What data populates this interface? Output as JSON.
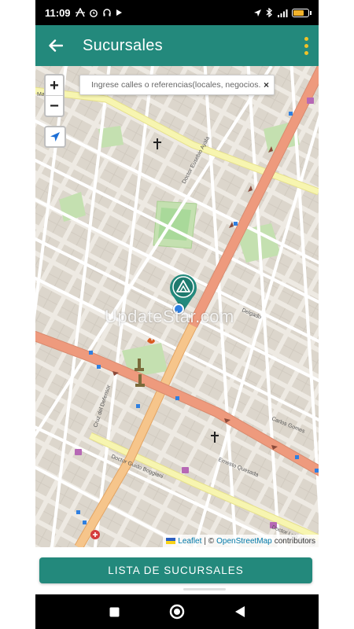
{
  "status_bar": {
    "time": "11:09",
    "battery_level": 0.75,
    "icons_left": [
      "network-activity-icon",
      "alarm-icon",
      "headset-icon",
      "play-icon"
    ],
    "icons_right": [
      "location-icon",
      "bluetooth-icon",
      "signal-icon",
      "battery-icon"
    ]
  },
  "app_bar": {
    "title": "Sucursales",
    "back_icon": "arrow-left-icon",
    "menu_icon": "more-vert-icon"
  },
  "map": {
    "zoom_in_label": "+",
    "zoom_out_label": "−",
    "locate_icon": "navigation-arrow-icon",
    "search_placeholder": "Ingrese calles o referencias(locales, negocios...)",
    "search_clear_label": "×",
    "watermark": "UpdateStar.com",
    "attribution": {
      "leaflet": "Leaflet",
      "separator": "| ©",
      "osm": "OpenStreetMap",
      "suffix": "contributors"
    },
    "street_labels": [
      "Doctor Guido Boggiani",
      "Doctor Luis Alberto",
      "Cruz del Defensor",
      "Ernesto Quesada",
      "Carlos Gomes",
      "Delgado",
      "Doctor Eusebio Ayala",
      "Mayor"
    ]
  },
  "bottom": {
    "list_button_label": "LISTA DE SUCURSALES"
  },
  "nav_bar": {
    "icons": [
      "recents-square-icon",
      "home-circle-icon",
      "back-triangle-icon"
    ]
  },
  "colors": {
    "primary": "#23897c",
    "accent": "#f2c227",
    "road_primary": "#ee9a7d",
    "road_secondary": "#f6c58b",
    "road_tertiary": "#f7f5b0",
    "park": "#c4e0b0",
    "location_blue": "#2f7fe0"
  }
}
